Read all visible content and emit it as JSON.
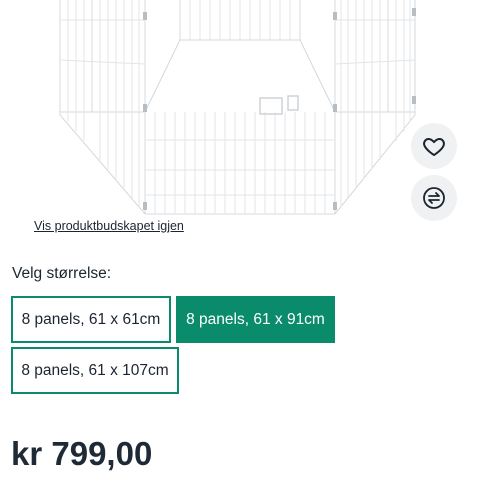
{
  "product": {
    "image_alt": "",
    "wishlist_icon": "heart-icon",
    "compare_icon": "compare-arrows-icon",
    "back_link_label": "Vis produktbudskapet igjen"
  },
  "size": {
    "label": "Velg størrelse:",
    "options": [
      {
        "label": "8 panels, 61 x 61cm",
        "selected": false
      },
      {
        "label": "8 panels, 61 x 91cm",
        "selected": true
      },
      {
        "label": "8 panels, 61 x 107cm",
        "selected": false
      }
    ]
  },
  "price": {
    "text": "kr 799,00"
  },
  "colors": {
    "accent": "#0a8c6c",
    "button_bg": "#f0f1f2"
  }
}
